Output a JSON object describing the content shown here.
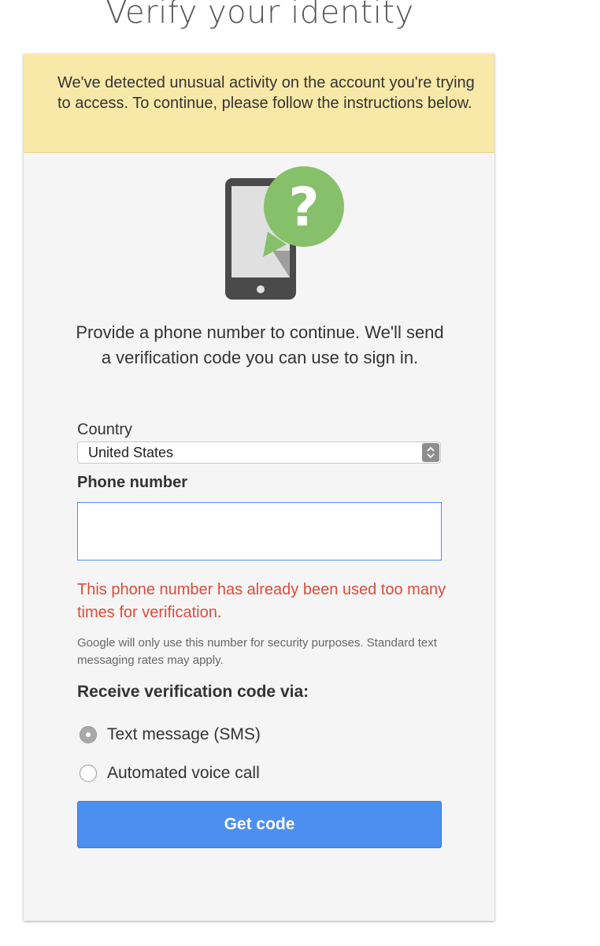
{
  "page": {
    "title": "Verify your identity"
  },
  "warning": {
    "text": "We've detected unusual activity on the account you're trying to access. To continue, please follow the instructions below."
  },
  "illustration": {
    "icon": "phone-question-icon",
    "colors": {
      "phone_body": "#4a4a4a",
      "screen": "#e0e0e0",
      "bubble": "#86c06a",
      "mark": "#ffffff"
    }
  },
  "prompt": {
    "text": "Provide a phone number to continue. We'll send a verification code you can use to sign in."
  },
  "country": {
    "label": "Country",
    "selected": "United States"
  },
  "phone": {
    "label": "Phone number",
    "value": ""
  },
  "error": {
    "text": "This phone number has already been used too many times for verification."
  },
  "note": {
    "text": "Google will only use this number for security purposes. Standard text messaging rates may apply."
  },
  "receive": {
    "label": "Receive verification code via:",
    "options": [
      {
        "label": "Text message (SMS)",
        "selected": true
      },
      {
        "label": "Automated voice call",
        "selected": false
      }
    ]
  },
  "actions": {
    "get_code_label": "Get code"
  },
  "colors": {
    "warning_bg": "#f9e9a8",
    "error": "#dd4b39",
    "button": "#4d8ff0",
    "input_border": "#4d90fe"
  }
}
